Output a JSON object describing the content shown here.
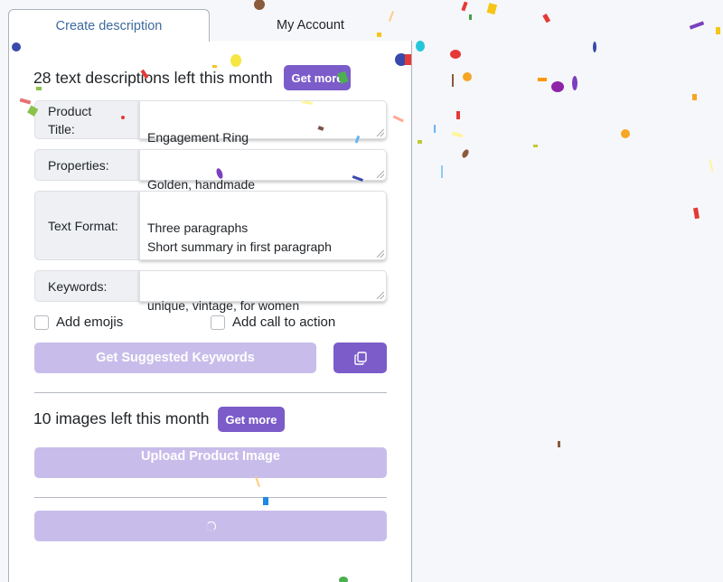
{
  "tabs": {
    "create": "Create description",
    "account": "My Account"
  },
  "text_quota": {
    "headline": "28 text descriptions left this month",
    "get_more": "Get more"
  },
  "form": {
    "product_title": {
      "label": "Product\nTitle:",
      "value": "Engagement Ring"
    },
    "properties": {
      "label": "Properties:",
      "value": "Golden, handmade"
    },
    "text_format": {
      "label": "Text Format:",
      "value": "Three paragraphs\nShort summary in first paragraph"
    },
    "keywords": {
      "label": "Keywords:",
      "value": "unique, vintage, for women"
    }
  },
  "options": {
    "emojis": "Add emojis",
    "call_to_action": "Add call to action"
  },
  "actions": {
    "suggest_keywords": "Get Suggested Keywords"
  },
  "image_quota": {
    "headline": "10 images left this month",
    "get_more": "Get more"
  },
  "upload": {
    "label": "Upload Product Image"
  },
  "colors": {
    "accent": "#7b5cc9",
    "accent_disabled": "#c8bdea",
    "tab_active_text": "#3d6a9e"
  }
}
